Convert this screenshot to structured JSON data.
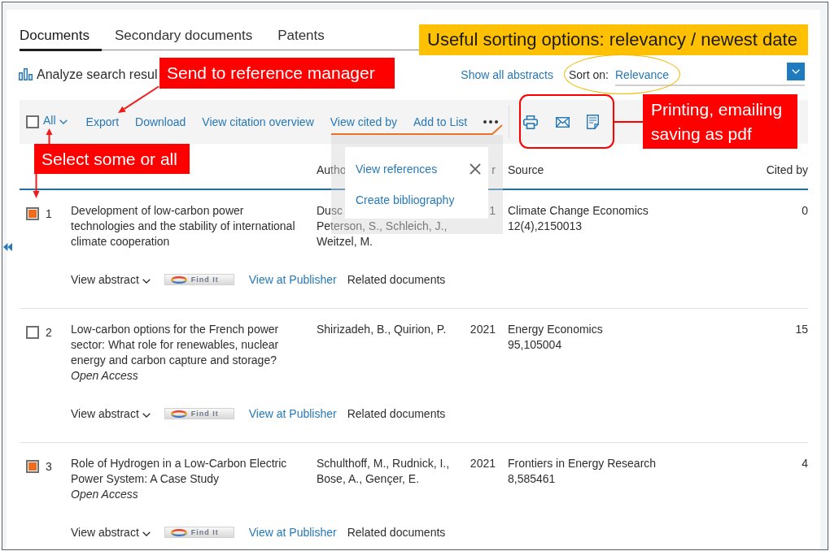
{
  "tabs": [
    {
      "label": "Documents",
      "selected": true
    },
    {
      "label": "Secondary documents",
      "selected": false
    },
    {
      "label": "Patents",
      "selected": false
    }
  ],
  "analyze_link": "Analyze search resul",
  "show_abstracts": "Show all abstracts",
  "sort": {
    "label": "Sort on:",
    "value": "Relevance"
  },
  "toolbar": {
    "select_all": {
      "label": "All",
      "checked": false
    },
    "actions": [
      "Export",
      "Download",
      "View citation overview",
      "View cited by",
      "Add to List"
    ]
  },
  "more_menu": {
    "items": [
      "View references",
      "Create bibliography"
    ]
  },
  "table": {
    "columns": [
      "Autho",
      "r",
      "Source",
      "Cited by"
    ],
    "rows": [
      {
        "number": "1",
        "selected": true,
        "title": "Development of low-carbon power technologies and the stability of international climate cooperation",
        "authors": "Dusc\nPeterson, S., Schleich, J.,\nWeitzel, M.",
        "year": "1",
        "source": "Climate Change Economics",
        "source_details": "12(4),2150013",
        "cited_by": "0",
        "links": {
          "abstract": "View abstract",
          "find_it": "Find It",
          "publisher": "View at Publisher",
          "related": "Related documents"
        }
      },
      {
        "number": "2",
        "selected": false,
        "title": "Low-carbon options for the French power sector: What role for renewables, nuclear energy and carbon capture and storage?",
        "access": "Open Access",
        "authors": "Shirizadeh, B., Quirion, P.",
        "year": "2021",
        "source": "Energy Economics",
        "source_details": "95,105004",
        "cited_by": "15",
        "links": {
          "abstract": "View abstract",
          "find_it": "Find It",
          "publisher": "View at Publisher",
          "related": "Related documents"
        }
      },
      {
        "number": "3",
        "selected": true,
        "title": "Role of Hydrogen in a Low-Carbon Electric Power System: A Case Study",
        "access": "Open Access",
        "authors": "Schulthoff, M., Rudnick, I., Bose, A., Gençer, E.",
        "year": "2021",
        "source": "Frontiers in Energy Research",
        "source_details": "8,585461",
        "cited_by": "4",
        "links": {
          "abstract": "View abstract",
          "find_it": "Find It",
          "publisher": "View at Publisher",
          "related": "Related documents"
        }
      }
    ]
  },
  "callouts": {
    "sorting": "Useful sorting options: relevancy / newest date",
    "reference_manager": "Send to reference manager",
    "selection": "Select some or all",
    "output": "Printing, emailing saving as pdf"
  }
}
